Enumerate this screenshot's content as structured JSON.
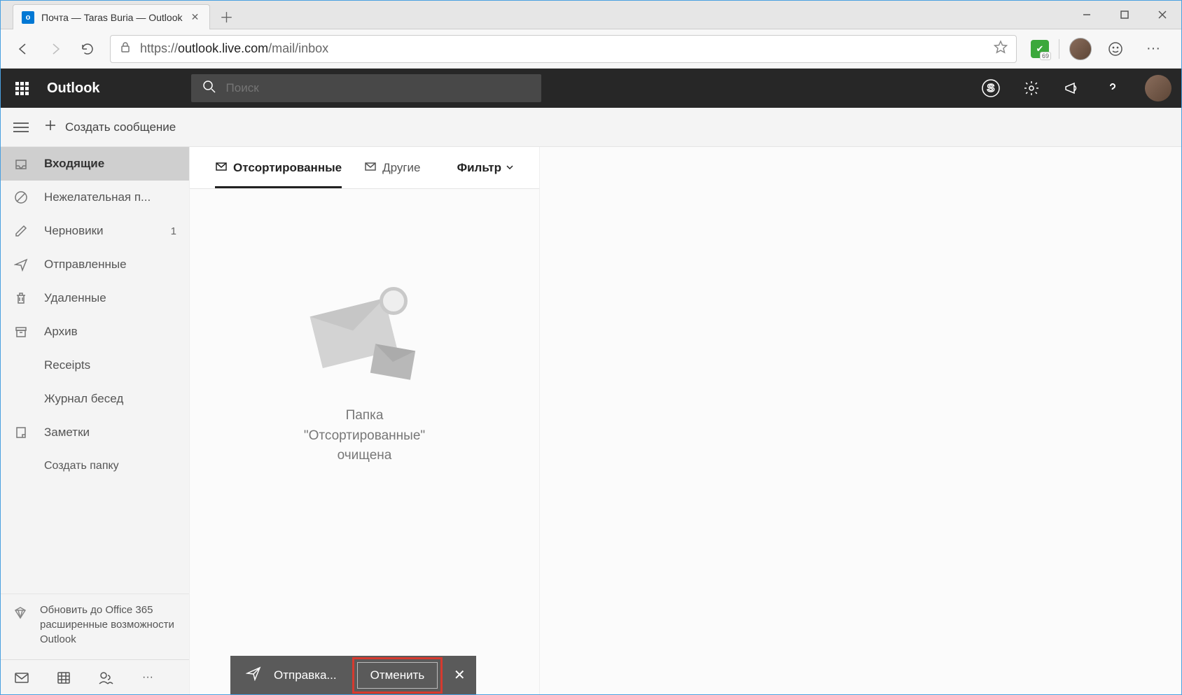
{
  "browser": {
    "tab_title": "Почта — Taras Buria — Outlook",
    "url_proto": "https://",
    "url_host": "outlook.live.com",
    "url_path": "/mail/inbox",
    "ext_badge": "69"
  },
  "header": {
    "brand": "Outlook",
    "search_placeholder": "Поиск"
  },
  "command_bar": {
    "new_message": "Создать сообщение"
  },
  "sidebar": {
    "folders": [
      {
        "label": "Входящие",
        "icon": "inbox",
        "count": "",
        "active": true
      },
      {
        "label": "Нежелательная п...",
        "icon": "blocked",
        "count": ""
      },
      {
        "label": "Черновики",
        "icon": "pencil",
        "count": "1"
      },
      {
        "label": "Отправленные",
        "icon": "send",
        "count": ""
      },
      {
        "label": "Удаленные",
        "icon": "trash",
        "count": ""
      },
      {
        "label": "Архив",
        "icon": "archive",
        "count": ""
      },
      {
        "label": "Receipts",
        "icon": "",
        "count": ""
      },
      {
        "label": "Журнал бесед",
        "icon": "",
        "count": ""
      },
      {
        "label": "Заметки",
        "icon": "note",
        "count": ""
      },
      {
        "label": "Создать папку",
        "icon": "",
        "count": "",
        "create": true
      }
    ],
    "promo": "Обновить до Office 365 расширенные возможности Outlook"
  },
  "pane": {
    "tab_focused": "Отсортированные",
    "tab_other": "Другие",
    "filter": "Фильтр",
    "empty": "Папка\n\"Отсортированные\"\nочищена"
  },
  "toast": {
    "sending": "Отправка...",
    "cancel": "Отменить"
  }
}
